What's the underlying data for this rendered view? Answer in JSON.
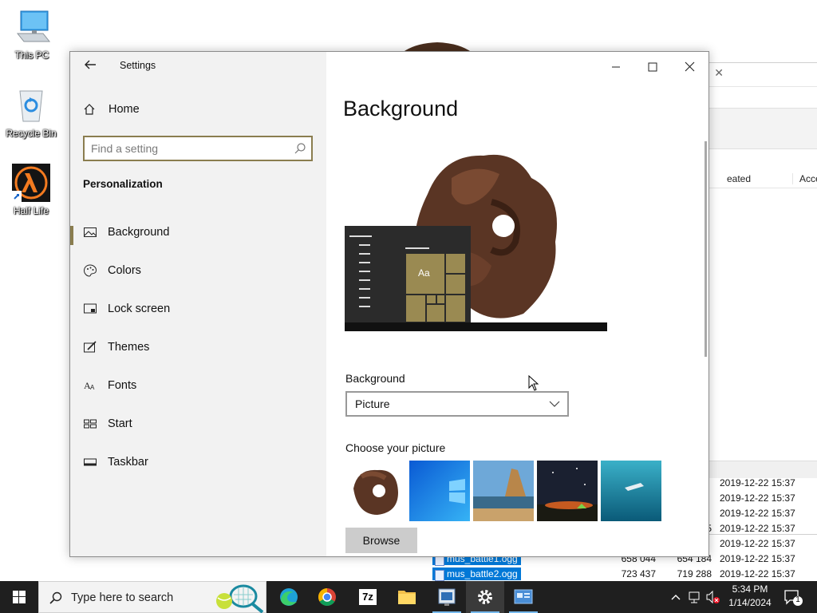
{
  "desktop": {
    "icons": [
      {
        "label": "This PC",
        "icon": "this-pc-icon"
      },
      {
        "label": "Recycle Bin",
        "icon": "recycle-bin-icon"
      },
      {
        "label": "Half Life",
        "icon": "half-life-icon"
      }
    ]
  },
  "explorer": {
    "columns": [
      "eated",
      "Acce"
    ],
    "files": [
      {
        "name": "",
        "size": "",
        "packed": "",
        "date": "2019-12-22 15:37",
        "selected": false
      },
      {
        "name": "",
        "size": "",
        "packed": "",
        "date": "2019-12-22 15:37",
        "selected": false
      },
      {
        "name": "",
        "size": "",
        "packed": "",
        "date": "2019-12-22 15:37",
        "selected": false
      },
      {
        "name": "",
        "size": "",
        "packed": "5",
        "date": "2019-12-22 15:37",
        "selected": false
      },
      {
        "name": "",
        "size": "",
        "packed": "",
        "date": "2019-12-22 15:37",
        "selected": false
      },
      {
        "name": "mus_battle1.ogg",
        "size": "658 044",
        "packed": "654 184",
        "date": "2019-12-22 15:37",
        "selected": true
      },
      {
        "name": "mus_battle2.ogg",
        "size": "723 437",
        "packed": "719 288",
        "date": "2019-12-22 15:37",
        "selected": true
      }
    ]
  },
  "settings": {
    "window_title": "Settings",
    "home_label": "Home",
    "search_placeholder": "Find a setting",
    "section_title": "Personalization",
    "nav": [
      {
        "label": "Background",
        "icon": "picture-icon",
        "active": true
      },
      {
        "label": "Colors",
        "icon": "palette-icon",
        "active": false
      },
      {
        "label": "Lock screen",
        "icon": "lock-screen-icon",
        "active": false
      },
      {
        "label": "Themes",
        "icon": "themes-icon",
        "active": false
      },
      {
        "label": "Fonts",
        "icon": "fonts-icon",
        "active": false
      },
      {
        "label": "Start",
        "icon": "start-icon",
        "active": false
      },
      {
        "label": "Taskbar",
        "icon": "taskbar-icon",
        "active": false
      }
    ],
    "page_title": "Background",
    "preview_tile_text": "Aa",
    "background_label": "Background",
    "background_value": "Picture",
    "choose_label": "Choose your picture",
    "browse_label": "Browse",
    "accent_color": "#8a7d4f"
  },
  "taskbar": {
    "search_placeholder": "Type here to search",
    "apps": [
      "edge-icon",
      "chrome-icon",
      "7zip-icon",
      "file-explorer-icon",
      "task-manager-icon",
      "settings-icon",
      "control-panel-icon"
    ],
    "time": "5:34 PM",
    "date": "1/14/2024",
    "notification_count": "1",
    "sevenzip_text": "7z"
  }
}
